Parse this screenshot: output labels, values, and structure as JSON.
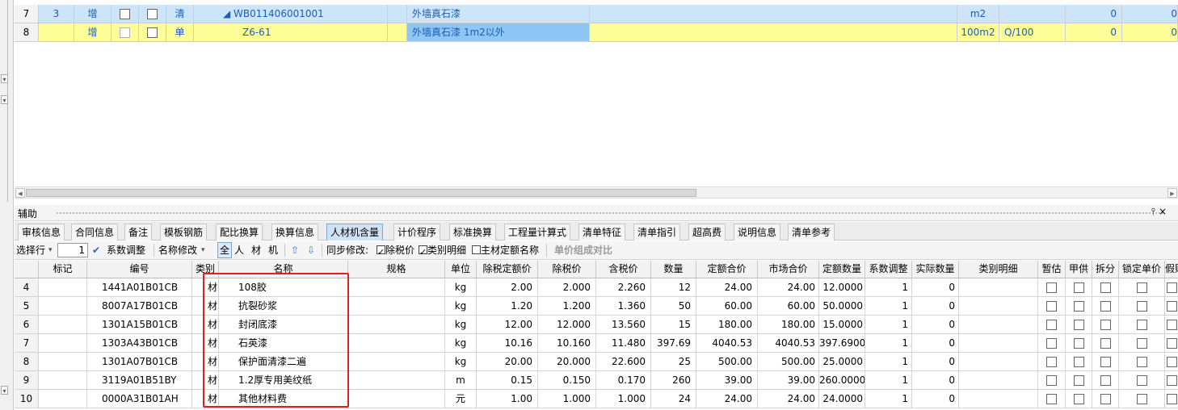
{
  "upper_rows": [
    {
      "row": "7",
      "seq": "3",
      "action": "增",
      "kind": "清",
      "code": "◢ WB011406001001",
      "name": "外墙真石漆",
      "unit": "m2",
      "expr": "",
      "v1": "0",
      "v2": "0"
    },
    {
      "row": "8",
      "seq": "",
      "action": "增",
      "kind": "单",
      "code": "Z6-61",
      "name": "外墙真石漆 1m2以外",
      "unit": "100m2",
      "expr": "Q/100",
      "v1": "0",
      "v2": "0"
    }
  ],
  "panel": {
    "title": "辅助",
    "pin": "⫯ ×"
  },
  "tabs": [
    "审核信息",
    "合同信息",
    "备注",
    "模板钢筋",
    "配比换算",
    "换算信息",
    "人材机含量",
    "计价程序",
    "标准换算",
    "工程量计算式",
    "清单特征",
    "清单指引",
    "超高费",
    "说明信息",
    "清单参考"
  ],
  "active_tab": "人材机含量",
  "toolbar": {
    "select_row": "选择行",
    "spin_value": "1",
    "coef_adjust": "系数调整",
    "name_modify": "名称修改",
    "filter_all": "全",
    "filter_labor": "人",
    "filter_material": "材",
    "filter_machine": "机",
    "sync_label": "同步修改:",
    "tax_excl": "除税价",
    "category_detail": "类别明细",
    "main_material_name": "主材定额名称",
    "compare": "单价组成对比"
  },
  "columns": [
    "标记",
    "编号",
    "类别",
    "名称",
    "规格",
    "单位",
    "除税定额价",
    "除税价",
    "含税价",
    "数量",
    "定额合价",
    "市场合价",
    "定额数量",
    "系数调整",
    "实际数量",
    "类别明细",
    "暂估",
    "甲供",
    "拆分",
    "锁定单价",
    "假账"
  ],
  "rows": [
    {
      "n": "4",
      "code": "1441A01B01CB",
      "cat": "材",
      "name": "108胶",
      "unit": "kg",
      "p1": "2.00",
      "p2": "2.000",
      "p3": "2.260",
      "qty": "12",
      "t1": "24.00",
      "t2": "24.00",
      "dq": "12.0000",
      "coef": "1",
      "aq": "0"
    },
    {
      "n": "5",
      "code": "8007A17B01CB",
      "cat": "材",
      "name": "抗裂砂浆",
      "unit": "kg",
      "p1": "1.20",
      "p2": "1.200",
      "p3": "1.360",
      "qty": "50",
      "t1": "60.00",
      "t2": "60.00",
      "dq": "50.0000",
      "coef": "1",
      "aq": "0"
    },
    {
      "n": "6",
      "code": "1301A15B01CB",
      "cat": "材",
      "name": "封闭底漆",
      "unit": "kg",
      "p1": "12.00",
      "p2": "12.000",
      "p3": "13.560",
      "qty": "15",
      "t1": "180.00",
      "t2": "180.00",
      "dq": "15.0000",
      "coef": "1",
      "aq": "0"
    },
    {
      "n": "7",
      "code": "1303A43B01CB",
      "cat": "材",
      "name": "石英漆",
      "unit": "kg",
      "p1": "10.16",
      "p2": "10.160",
      "p3": "11.480",
      "qty": "397.69",
      "t1": "4040.53",
      "t2": "4040.53",
      "dq": "397.6900",
      "coef": "1",
      "aq": "0"
    },
    {
      "n": "8",
      "code": "1301A07B01CB",
      "cat": "材",
      "name": "保护面清漆二遍",
      "unit": "kg",
      "p1": "20.00",
      "p2": "20.000",
      "p3": "22.600",
      "qty": "25",
      "t1": "500.00",
      "t2": "500.00",
      "dq": "25.0000",
      "coef": "1",
      "aq": "0"
    },
    {
      "n": "9",
      "code": "3119A01B51BY",
      "cat": "材",
      "name": "1.2厚专用美纹纸",
      "unit": "m",
      "p1": "0.15",
      "p2": "0.150",
      "p3": "0.170",
      "qty": "260",
      "t1": "39.00",
      "t2": "39.00",
      "dq": "260.0000",
      "coef": "1",
      "aq": "0"
    },
    {
      "n": "10",
      "code": "0000A31B01AH",
      "cat": "材",
      "name": "其他材料费",
      "unit": "元",
      "p1": "1.00",
      "p2": "1.000",
      "p3": "1.000",
      "qty": "24",
      "t1": "24.00",
      "t2": "24.00",
      "dq": "24.0000",
      "coef": "1",
      "aq": "0"
    }
  ],
  "colors": {
    "selected_row": "#cde5fb",
    "highlight_row": "#ffff99",
    "active_cell": "#8fc6f5",
    "red_annotation": "#e02020"
  }
}
